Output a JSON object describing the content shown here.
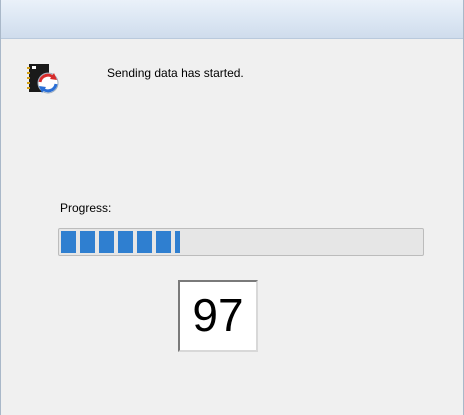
{
  "dialog": {
    "message": "Sending data has started.",
    "progress_label": "Progress:",
    "progress_fraction": 0.33,
    "progress_color": "#2f7fd0",
    "counter_value": "97",
    "icon": "data-transfer-icon"
  }
}
